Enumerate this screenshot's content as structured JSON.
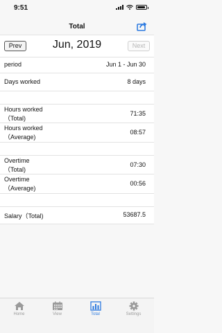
{
  "status": {
    "time": "9:51"
  },
  "nav": {
    "title": "Total"
  },
  "month": {
    "prev_label": "Prev",
    "label": "Jun, 2019",
    "next_label": "Next"
  },
  "rows": {
    "period": {
      "label": "period",
      "value": "Jun 1 - Jun 30"
    },
    "days": {
      "label": "Days worked",
      "value": "8 days"
    },
    "hours_total": {
      "label1": "Hours worked",
      "label2": "（Total)",
      "value": "71:35"
    },
    "hours_avg": {
      "label1": "Hours worked",
      "label2": "（Average)",
      "value": "08:57"
    },
    "overtime_total": {
      "label1": "Overtime",
      "label2": "（Total)",
      "value": "07:30"
    },
    "overtime_avg": {
      "label1": "Overtime",
      "label2": "（Average)",
      "value": "00:56"
    },
    "salary": {
      "label": "Salary（Total)",
      "value": "53687.5"
    }
  },
  "tabs": [
    {
      "label": "Home",
      "icon": "home-icon"
    },
    {
      "label": "View",
      "icon": "calendar-icon"
    },
    {
      "label": "Total",
      "icon": "bar-chart-icon"
    },
    {
      "label": "Settings",
      "icon": "gear-icon"
    }
  ],
  "colors": {
    "accent": "#2e7be0",
    "inactive": "#9a9a9a"
  }
}
